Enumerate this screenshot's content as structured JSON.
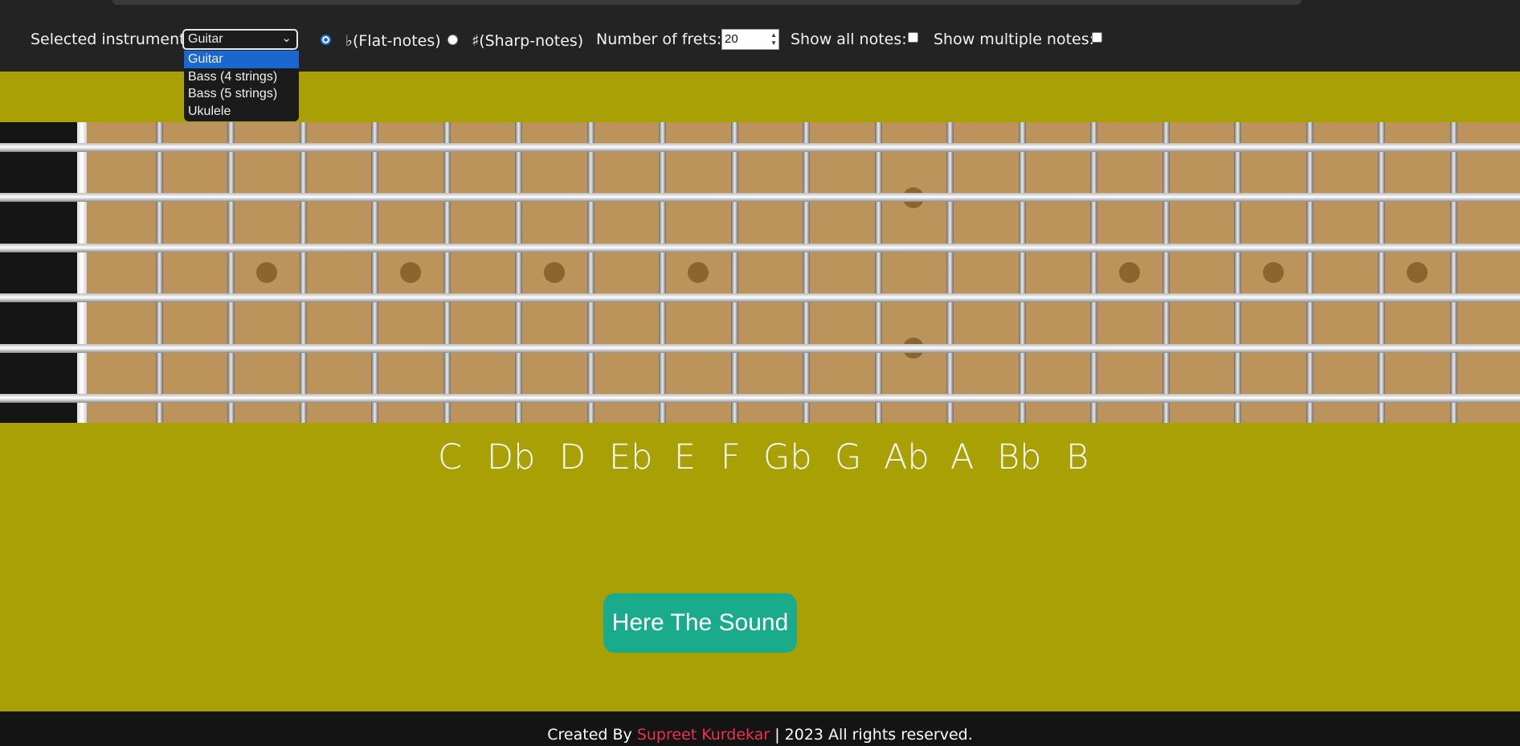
{
  "controls": {
    "instrument_label": "Selected instrument:",
    "instrument_selected": "Guitar",
    "instrument_options": [
      "Guitar",
      "Bass (4 strings)",
      "Bass (5 strings)",
      "Ukulele"
    ],
    "flat_label": "♭(Flat-notes)",
    "sharp_label": "♯(Sharp-notes)",
    "flat_checked": true,
    "frets_label": "Number of frets:",
    "frets_value": "20",
    "show_all_label": "Show all notes:",
    "show_multiple_label": "Show multiple notes:"
  },
  "fretboard": {
    "strings": 6,
    "single_inlay_frets": [
      3,
      5,
      7,
      9,
      15,
      17,
      19
    ],
    "double_inlay_frets": [
      12
    ],
    "colors": {
      "board": "#bd935c",
      "inlay": "#8a6530",
      "background": "#a8a004"
    }
  },
  "notes": [
    "C",
    "Db",
    "D",
    "Eb",
    "E",
    "F",
    "Gb",
    "G",
    "Ab",
    "A",
    "Bb",
    "B"
  ],
  "sound_button": "Here The Sound",
  "footer": {
    "prefix": "Created By",
    "author": "Supreet Kurdekar",
    "suffix": "| 2023 All rights reserved."
  },
  "icons": {
    "select": "chevron-down-icon",
    "stepper": "spinner-arrows-icon"
  }
}
